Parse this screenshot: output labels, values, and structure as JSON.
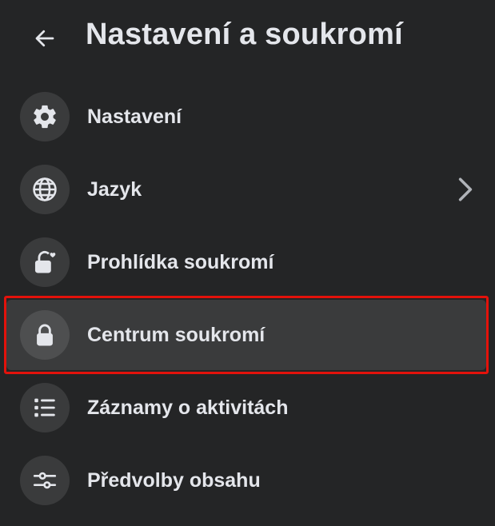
{
  "header": {
    "title": "Nastavení a soukromí",
    "back_icon": "arrow-left-icon"
  },
  "menu": {
    "items": [
      {
        "label": "Nastavení",
        "icon": "gear-icon",
        "has_chevron": false,
        "selected": false
      },
      {
        "label": "Jazyk",
        "icon": "globe-icon",
        "has_chevron": true,
        "selected": false
      },
      {
        "label": "Prohlídka soukromí",
        "icon": "lock-heart-icon",
        "has_chevron": false,
        "selected": false
      },
      {
        "label": "Centrum soukromí",
        "icon": "lock-icon",
        "has_chevron": false,
        "selected": true
      },
      {
        "label": "Záznamy o aktivitách",
        "icon": "list-icon",
        "has_chevron": false,
        "selected": false
      },
      {
        "label": "Předvolby obsahu",
        "icon": "sliders-icon",
        "has_chevron": false,
        "selected": false
      }
    ]
  },
  "colors": {
    "background": "#242526",
    "icon_circle": "#3a3b3c",
    "selected_row": "#3a3b3c",
    "text": "#e4e6eb",
    "highlight_border": "#e3120b"
  }
}
